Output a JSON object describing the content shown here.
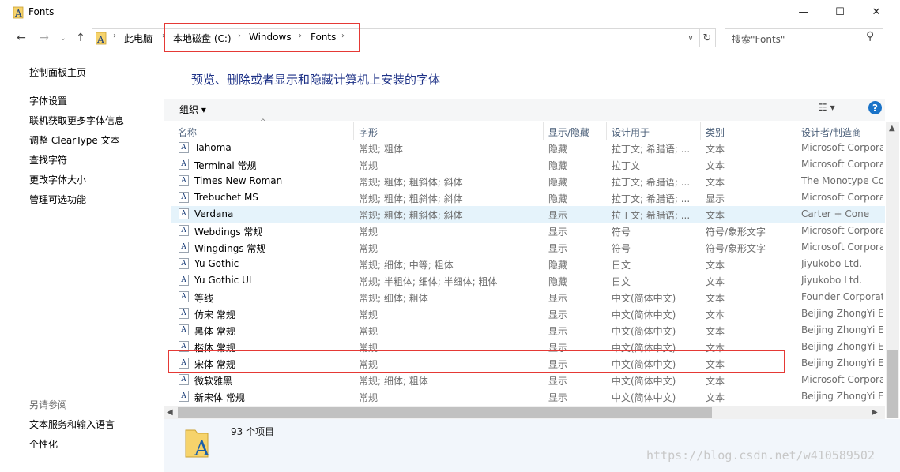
{
  "window": {
    "title": "Fonts",
    "minimize": "—",
    "maximize": "☐",
    "close": "✕"
  },
  "nav": {
    "back": "←",
    "forward": "→",
    "dropdown": "⌄",
    "up": "↑"
  },
  "address": {
    "root": "此电脑",
    "crumbs": [
      "本地磁盘 (C:)",
      "Windows",
      "Fonts"
    ],
    "dropdown": "∨",
    "refresh": "↻"
  },
  "search": {
    "placeholder": "搜索\"Fonts\""
  },
  "left_pane": {
    "home": "控制面板主页",
    "links": [
      "字体设置",
      "联机获取更多字体信息",
      "调整 ClearType 文本",
      "查找字符",
      "更改字体大小",
      "管理可选功能"
    ],
    "see_also_title": "另请参阅",
    "see_also": [
      "文本服务和输入语言",
      "个性化"
    ]
  },
  "main": {
    "heading": "预览、删除或者显示和隐藏计算机上安装的字体",
    "organize": "组织 ▾",
    "view": "☷ ▾",
    "help": "?",
    "columns": [
      "名称",
      "字形",
      "显示/隐藏",
      "设计用于",
      "类别",
      "设计者/制造商"
    ],
    "rows": [
      {
        "name": "Tahoma",
        "style": "常规; 粗体",
        "show": "隐藏",
        "design": "拉丁文; 希腊语; ...",
        "cat": "文本",
        "vendor": "Microsoft Corporation",
        "icon": "A",
        "selected": false
      },
      {
        "name": "Terminal 常规",
        "style": "常规",
        "show": "隐藏",
        "design": "拉丁文",
        "cat": "文本",
        "vendor": "Microsoft Corporation",
        "icon": "A",
        "selected": false
      },
      {
        "name": "Times New Roman",
        "style": "常规; 粗体; 粗斜体; 斜体",
        "show": "隐藏",
        "design": "拉丁文; 希腊语; ...",
        "cat": "文本",
        "vendor": "The Monotype Corporation",
        "icon": "A",
        "selected": false
      },
      {
        "name": "Trebuchet MS",
        "style": "常规; 粗体; 粗斜体; 斜体",
        "show": "隐藏",
        "design": "拉丁文; 希腊语; ...",
        "cat": "显示",
        "vendor": "Microsoft Corporation",
        "icon": "A",
        "selected": false
      },
      {
        "name": "Verdana",
        "style": "常规; 粗体; 粗斜体; 斜体",
        "show": "显示",
        "design": "拉丁文; 希腊语; ...",
        "cat": "文本",
        "vendor": "Carter + Cone",
        "icon": "A",
        "selected": true
      },
      {
        "name": "Webdings 常规",
        "style": "常规",
        "show": "显示",
        "design": "符号",
        "cat": "符号/象形文字",
        "vendor": "Microsoft Corporation",
        "icon": "A",
        "selected": false
      },
      {
        "name": "Wingdings 常规",
        "style": "常规",
        "show": "显示",
        "design": "符号",
        "cat": "符号/象形文字",
        "vendor": "Microsoft Corporation",
        "icon": "A",
        "selected": false
      },
      {
        "name": "Yu Gothic",
        "style": "常规; 细体; 中等; 粗体",
        "show": "隐藏",
        "design": "日文",
        "cat": "文本",
        "vendor": "Jiyukobo Ltd.",
        "icon": "A",
        "selected": false
      },
      {
        "name": "Yu Gothic UI",
        "style": "常规; 半粗体; 细体; 半细体; 粗体",
        "show": "隐藏",
        "design": "日文",
        "cat": "文本",
        "vendor": "Jiyukobo Ltd.",
        "icon": "A",
        "selected": false
      },
      {
        "name": "等线",
        "style": "常规; 细体; 粗体",
        "show": "显示",
        "design": "中文(简体中文)",
        "cat": "文本",
        "vendor": "Founder Corporation",
        "icon": "A",
        "selected": false
      },
      {
        "name": "仿宋 常规",
        "style": "常规",
        "show": "显示",
        "design": "中文(简体中文)",
        "cat": "文本",
        "vendor": "Beijing ZhongYi Electronics",
        "icon": "A",
        "selected": false
      },
      {
        "name": "黑体 常规",
        "style": "常规",
        "show": "显示",
        "design": "中文(简体中文)",
        "cat": "文本",
        "vendor": "Beijing ZhongYi Electronics",
        "icon": "A",
        "selected": false
      },
      {
        "name": "楷体 常规",
        "style": "常规",
        "show": "显示",
        "design": "中文(简体中文)",
        "cat": "文本",
        "vendor": "Beijing ZhongYi Electronics",
        "icon": "A",
        "selected": false
      },
      {
        "name": "宋体 常规",
        "style": "常规",
        "show": "显示",
        "design": "中文(简体中文)",
        "cat": "文本",
        "vendor": "Beijing ZhongYi Electronics",
        "icon": "A",
        "selected": false
      },
      {
        "name": "微软雅黑",
        "style": "常规; 细体; 粗体",
        "show": "显示",
        "design": "中文(简体中文)",
        "cat": "文本",
        "vendor": "Microsoft Corporation",
        "icon": "A",
        "selected": false
      },
      {
        "name": "新宋体 常规",
        "style": "常规",
        "show": "显示",
        "design": "中文(简体中文)",
        "cat": "文本",
        "vendor": "Beijing ZhongYi Electronics",
        "icon": "A",
        "selected": false
      }
    ]
  },
  "details": {
    "count": "93 个项目"
  },
  "watermark": "https://blog.csdn.net/w410589502",
  "colors": {
    "accent": "#1e3287",
    "highlight_border": "#e53935",
    "selected_row": "#e5f3fb"
  }
}
